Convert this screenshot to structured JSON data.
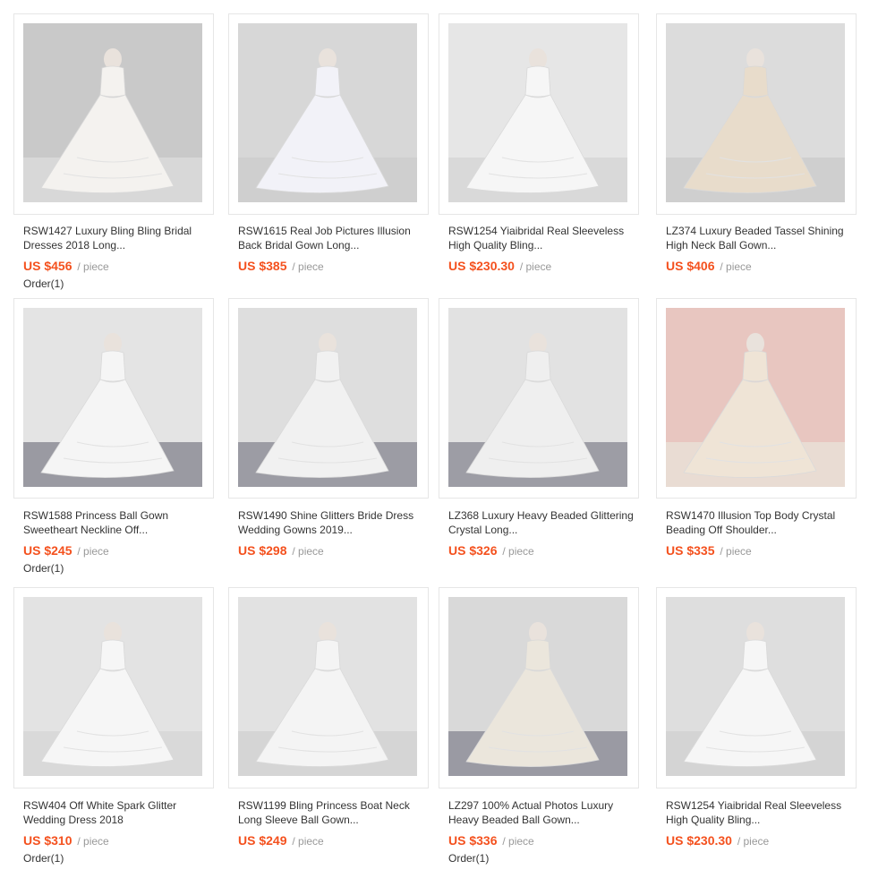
{
  "products": [
    {
      "title_line1": "RSW1427 Luxury Bling Bling Bridal",
      "title_line2": "Dresses 2018 Long...",
      "price": "US $456",
      "unit": "/ piece",
      "orders": "Order(1)",
      "image": "wedding-gown-photo",
      "bg": "#c9c9c9",
      "floor": "#d8d8d8",
      "gown": "#f4f2ef"
    },
    {
      "title_line1": "RSW1615 Real Job Pictures Illusion",
      "title_line2": "Back Bridal Gown Long...",
      "price": "US $385",
      "unit": "/ piece",
      "orders": "",
      "image": "wedding-gown-photo",
      "bg": "#d7d7d7",
      "floor": "#cfcfcf",
      "gown": "#f2f2f8"
    },
    {
      "title_line1": "RSW1254 Yiaibridal Real Sleeveless",
      "title_line2": "High Quality Bling...",
      "price": "US $230.30",
      "unit": "/ piece",
      "orders": "",
      "image": "wedding-gown-photo",
      "bg": "#e6e6e6",
      "floor": "#d9d9d9",
      "gown": "#f6f6f6"
    },
    {
      "title_line1": "LZ374 Luxury Beaded Tassel Shining",
      "title_line2": "High Neck Ball Gown...",
      "price": "US $406",
      "unit": "/ piece",
      "orders": "",
      "image": "wedding-gown-photo",
      "bg": "#dcdcdc",
      "floor": "#cfcfcf",
      "gown": "#e8dccb"
    },
    {
      "title_line1": "RSW1588 Princess Ball Gown",
      "title_line2": "Sweetheart Neckline Off...",
      "price": "US $245",
      "unit": "/ piece",
      "orders": "Order(1)",
      "image": "wedding-gown-photo",
      "bg": "#e4e4e4",
      "floor": "#9a9aa2",
      "gown": "#f5f5f5"
    },
    {
      "title_line1": "RSW1490 Shine Glitters Bride Dress",
      "title_line2": "Wedding Gowns 2019...",
      "price": "US $298",
      "unit": "/ piece",
      "orders": "",
      "image": "wedding-gown-photo",
      "bg": "#dedede",
      "floor": "#9c9ca4",
      "gown": "#f1f1f1"
    },
    {
      "title_line1": "LZ368 Luxury Heavy Beaded Glittering",
      "title_line2": "Crystal Long...",
      "price": "US $326",
      "unit": "/ piece",
      "orders": "",
      "image": "wedding-gown-photo",
      "bg": "#e2e2e2",
      "floor": "#9d9da5",
      "gown": "#efefef"
    },
    {
      "title_line1": "RSW1470 Illusion Top Body Crystal",
      "title_line2": "Beading Off Shoulder...",
      "price": "US $335",
      "unit": "/ piece",
      "orders": "",
      "image": "wedding-gown-photo",
      "bg": "#e8c6c0",
      "floor": "#e9dcd3",
      "gown": "#efe4d6"
    },
    {
      "title_line1": "RSW404 Off White Spark Glitter",
      "title_line2": "Wedding Dress 2018",
      "price": "US $310",
      "unit": "/ piece",
      "orders": "Order(1)",
      "image": "wedding-gown-photo",
      "bg": "#e3e3e3",
      "floor": "#d9d9d9",
      "gown": "#f6f6f6"
    },
    {
      "title_line1": "RSW1199 Bling Princess Boat Neck",
      "title_line2": "Long Sleeve Ball Gown...",
      "price": "US $249",
      "unit": "/ piece",
      "orders": "",
      "image": "wedding-gown-photo",
      "bg": "#e2e2e2",
      "floor": "#d5d5d5",
      "gown": "#f4f4f4"
    },
    {
      "title_line1": "LZ297 100% Actual Photos Luxury",
      "title_line2": "Heavy Beaded Ball Gown...",
      "price": "US $336",
      "unit": "/ piece",
      "orders": "Order(1)",
      "image": "wedding-gown-photo",
      "bg": "#d9d9d9",
      "floor": "#9a9aa3",
      "gown": "#ebe6dc"
    },
    {
      "title_line1": "RSW1254 Yiaibridal Real Sleeveless",
      "title_line2": "High Quality Bling...",
      "price": "US $230.30",
      "unit": "/ piece",
      "orders": "",
      "image": "wedding-gown-photo",
      "bg": "#dedede",
      "floor": "#d4d4d4",
      "gown": "#f6f6f6"
    }
  ]
}
